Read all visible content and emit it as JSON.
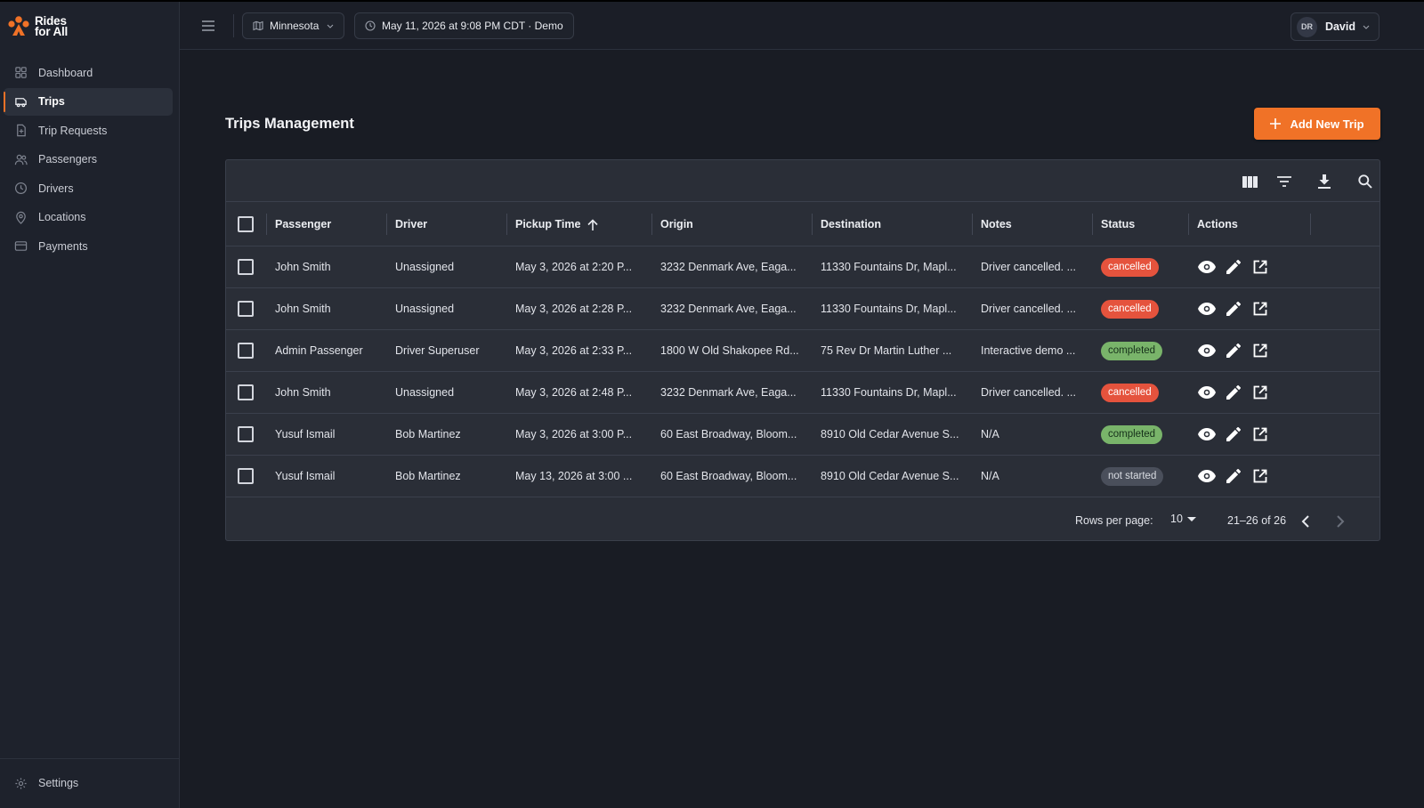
{
  "brand": {
    "name_line1": "Rides",
    "name_line2": "for All",
    "color": "#f07227"
  },
  "sidebar": {
    "items": [
      {
        "label": "Dashboard",
        "icon": "dashboard-icon",
        "active": false
      },
      {
        "label": "Trips",
        "icon": "trips-icon",
        "active": true
      },
      {
        "label": "Trip Requests",
        "icon": "trip-requests-icon",
        "active": false
      },
      {
        "label": "Passengers",
        "icon": "passengers-icon",
        "active": false
      },
      {
        "label": "Drivers",
        "icon": "drivers-icon",
        "active": false
      },
      {
        "label": "Locations",
        "icon": "location-pin-icon",
        "active": false
      },
      {
        "label": "Payments",
        "icon": "credit-card-icon",
        "active": false
      }
    ],
    "settings_label": "Settings"
  },
  "header": {
    "region": "Minnesota",
    "datetime": "May 11, 2026 at 9:08 PM CDT · Demo",
    "user_initials": "DR",
    "user_name": "David"
  },
  "main": {
    "title": "Trips Management",
    "add_button_label": "Add New Trip"
  },
  "table": {
    "columns": [
      "Passenger",
      "Driver",
      "Pickup Time",
      "Origin",
      "Destination",
      "Notes",
      "Status",
      "Actions"
    ],
    "sort_column": "Pickup Time",
    "sort_direction": "ascending",
    "rows": [
      {
        "passenger": "John Smith",
        "driver": "Unassigned",
        "pickup": "May 3, 2026 at 2:20 P...",
        "origin": "3232 Denmark Ave, Eaga...",
        "destination": "11330 Fountains Dr, Mapl...",
        "notes": "Driver cancelled. ...",
        "status": "cancelled"
      },
      {
        "passenger": "John Smith",
        "driver": "Unassigned",
        "pickup": "May 3, 2026 at 2:28 P...",
        "origin": "3232 Denmark Ave, Eaga...",
        "destination": "11330 Fountains Dr, Mapl...",
        "notes": "Driver cancelled. ...",
        "status": "cancelled"
      },
      {
        "passenger": "Admin Passenger",
        "driver": "Driver Superuser",
        "pickup": "May 3, 2026 at 2:33 P...",
        "origin": "1800 W Old Shakopee Rd...",
        "destination": "75 Rev Dr Martin Luther ...",
        "notes": "Interactive demo ...",
        "status": "completed"
      },
      {
        "passenger": "John Smith",
        "driver": "Unassigned",
        "pickup": "May 3, 2026 at 2:48 P...",
        "origin": "3232 Denmark Ave, Eaga...",
        "destination": "11330 Fountains Dr, Mapl...",
        "notes": "Driver cancelled. ...",
        "status": "cancelled"
      },
      {
        "passenger": "Yusuf Ismail",
        "driver": "Bob Martinez",
        "pickup": "May 3, 2026 at 3:00 P...",
        "origin": "60 East Broadway, Bloom...",
        "destination": "8910 Old Cedar Avenue S...",
        "notes": "N/A",
        "status": "completed"
      },
      {
        "passenger": "Yusuf Ismail",
        "driver": "Bob Martinez",
        "pickup": "May 13, 2026 at 3:00 ...",
        "origin": "60 East Broadway, Bloom...",
        "destination": "8910 Old Cedar Avenue S...",
        "notes": "N/A",
        "status": "not started"
      }
    ],
    "status_colors": {
      "cancelled": {
        "bg": "#e5533d",
        "fg": "#ffffff"
      },
      "completed": {
        "bg": "#79b46a",
        "fg": "#16301a"
      },
      "not started": {
        "bg": "#4a4f5b",
        "fg": "#d9dce2"
      }
    },
    "toolbar_icons": [
      "columns-icon",
      "filter-icon",
      "download-icon",
      "search-icon"
    ],
    "row_action_icons": [
      "eye-icon",
      "pencil-icon",
      "external-link-icon"
    ],
    "footer": {
      "rows_per_page_label": "Rows per page:",
      "rows_per_page_value": "10",
      "range_text": "21–26 of 26"
    }
  }
}
